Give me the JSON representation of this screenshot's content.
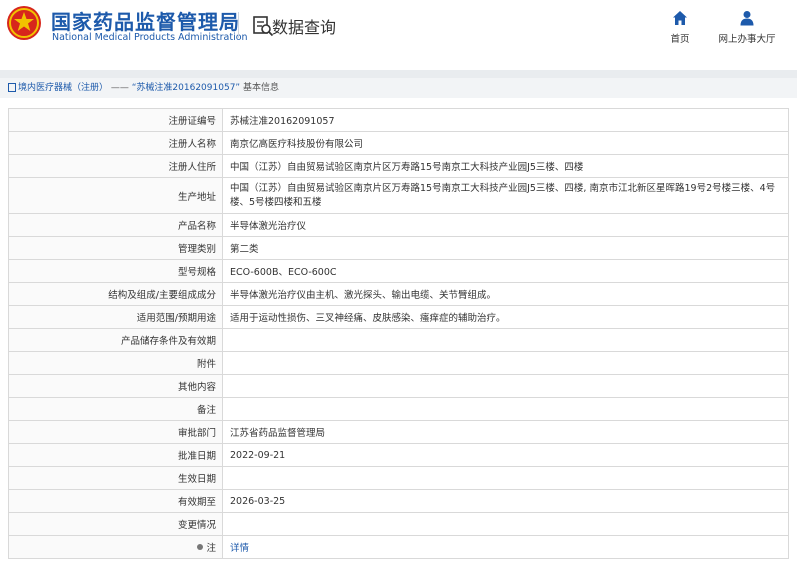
{
  "header": {
    "org_cn": "国家药品监督管理局",
    "org_en": "National Medical Products Administration",
    "system_title": "数据查询",
    "nav": [
      {
        "label": "首页",
        "icon": "home-icon"
      },
      {
        "label": "网上办事大厅",
        "icon": "person-icon"
      }
    ]
  },
  "breadcrumb": {
    "part1": "境内医疗器械（注册）",
    "sep": "——",
    "part2": "“苏械注准20162091057”",
    "part3": "基本信息"
  },
  "rows": [
    {
      "key": "注册证编号",
      "value": "苏械注准20162091057"
    },
    {
      "key": "注册人名称",
      "value": "南京亿高医疗科技股份有限公司"
    },
    {
      "key": "注册人住所",
      "value": "中国（江苏）自由贸易试验区南京片区万寿路15号南京工大科技产业园J5三楼、四楼"
    },
    {
      "key": "生产地址",
      "value": "中国（江苏）自由贸易试验区南京片区万寿路15号南京工大科技产业园J5三楼、四楼, 南京市江北新区星晖路19号2号楼三楼、4号楼、5号楼四楼和五楼"
    },
    {
      "key": "产品名称",
      "value": "半导体激光治疗仪"
    },
    {
      "key": "管理类别",
      "value": "第二类"
    },
    {
      "key": "型号规格",
      "value": "ECO-600B、ECO-600C"
    },
    {
      "key": "结构及组成/主要组成成分",
      "value": "半导体激光治疗仪由主机、激光探头、输出电缆、关节臂组成。"
    },
    {
      "key": "适用范围/预期用途",
      "value": "适用于运动性损伤、三叉神经痛、皮肤感染、瘙痒症的辅助治疗。"
    },
    {
      "key": "产品储存条件及有效期",
      "value": ""
    },
    {
      "key": "附件",
      "value": ""
    },
    {
      "key": "其他内容",
      "value": ""
    },
    {
      "key": "备注",
      "value": ""
    },
    {
      "key": "审批部门",
      "value": "江苏省药品监督管理局"
    },
    {
      "key": "批准日期",
      "value": "2022-09-21"
    },
    {
      "key": "生效日期",
      "value": ""
    },
    {
      "key": "有效期至",
      "value": "2026-03-25"
    },
    {
      "key": "变更情况",
      "value": ""
    },
    {
      "key": "注",
      "value": "详情"
    }
  ],
  "colors": {
    "brand_blue": "#1d5aab",
    "emblem_red": "#d7261c",
    "emblem_gold": "#f2c200"
  }
}
